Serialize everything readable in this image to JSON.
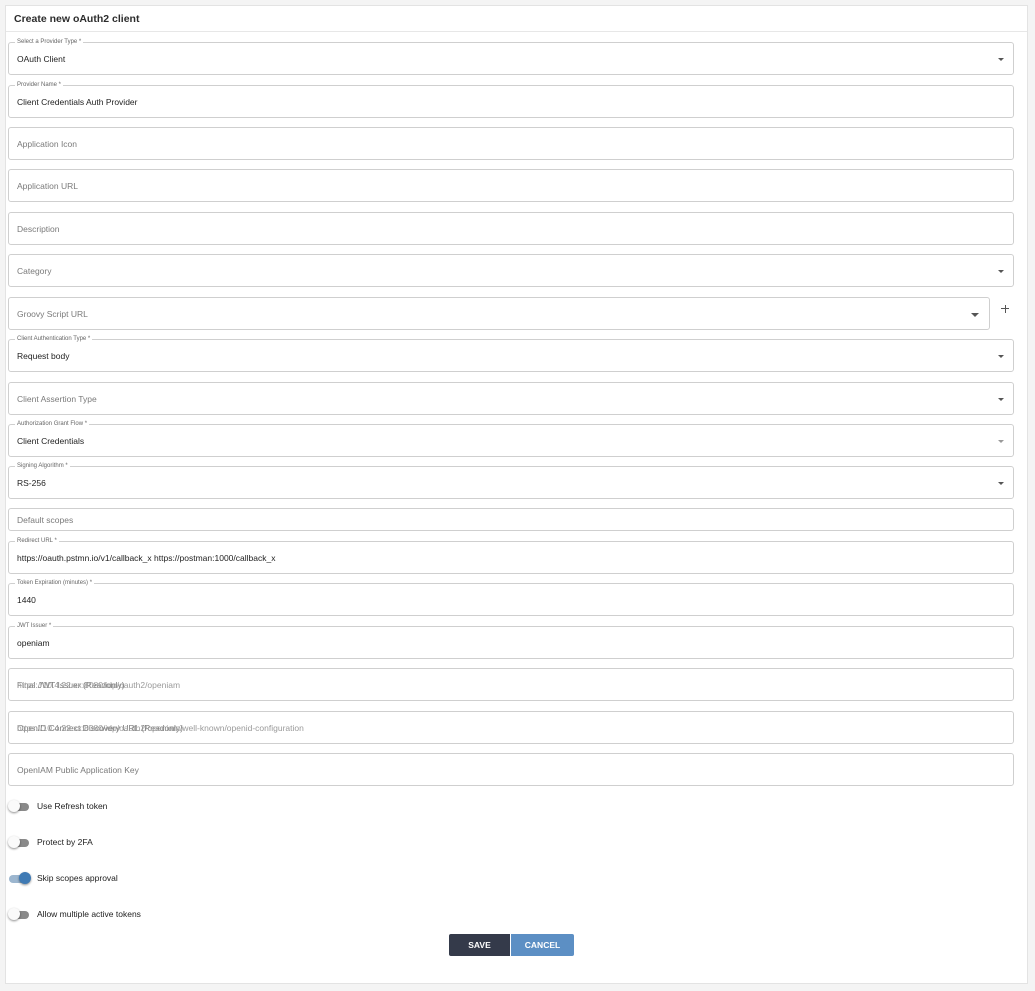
{
  "header": {
    "title": "Create new oAuth2 client"
  },
  "fields": {
    "provider_type": {
      "label": "Select a Provider Type *",
      "value": "OAuth Client"
    },
    "provider_name": {
      "label": "Provider Name *",
      "value": "Client Credentials Auth Provider"
    },
    "application_icon": {
      "placeholder": "Application Icon"
    },
    "application_url": {
      "placeholder": "Application URL"
    },
    "description": {
      "placeholder": "Description"
    },
    "category": {
      "placeholder": "Category"
    },
    "groovy_script_url": {
      "placeholder": "Groovy Script URL"
    },
    "client_auth_type": {
      "label": "Client Authentication Type *",
      "value": "Request body"
    },
    "client_assertion_type": {
      "placeholder": "Client Assertion Type"
    },
    "grant_flow": {
      "label": "Authorization Grant Flow *",
      "value": "Client Credentials"
    },
    "signing_algorithm": {
      "label": "Signing Algorithm *",
      "value": "RS-256"
    },
    "default_scopes": {
      "placeholder": "Default scopes"
    },
    "redirect_url": {
      "label": "Redirect URL *",
      "value": "https://oauth.pstmn.io/v1/callback_x https://postman:1000/callback_x"
    },
    "token_expiration": {
      "label": "Token Expiration (minutes) *",
      "value": "1440"
    },
    "jwt_issuer": {
      "label": "JWT Issuer *",
      "value": "openiam"
    },
    "final_jwt_issuer": {
      "placeholder": "Final JWT Issuer (Readonly)",
      "overlay": "https://10.4.22.xx:8080/idp/oauth2/openiam"
    },
    "openid_discovery_url": {
      "placeholder": "OpenID Connect Discovery URL (Readonly)",
      "overlay": "https://10.4.22.xx:8080/idp/oauth2/openiam/well-known/openid-configuration"
    },
    "public_app_key": {
      "placeholder": "OpenIAM Public Application Key"
    }
  },
  "toggles": {
    "use_refresh_token": {
      "label": "Use Refresh token",
      "on": false
    },
    "protect_2fa": {
      "label": "Protect by 2FA",
      "on": false
    },
    "skip_scopes": {
      "label": "Skip scopes approval",
      "on": true
    },
    "multiple_tokens": {
      "label": "Allow multiple active tokens",
      "on": false
    }
  },
  "buttons": {
    "save": "SAVE",
    "cancel": "CANCEL"
  },
  "colors": {
    "save_bg": "#343a4a",
    "cancel_bg": "#5c8fc4",
    "toggle_on": "#3f7ab4"
  }
}
